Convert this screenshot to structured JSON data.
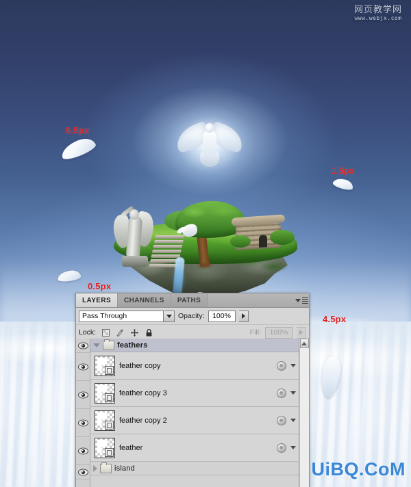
{
  "scene": {
    "title": "Floating island photo composite with doves and feathers",
    "sky_top_color": "#2c3a5e",
    "sky_bottom_color": "#f3f7fb",
    "annotation_color": "#e01f1f"
  },
  "annotations": [
    {
      "id": "feather-top-left",
      "label": "0.5px"
    },
    {
      "id": "feather-right",
      "label": "1.5px"
    },
    {
      "id": "feather-island-left",
      "label": "0.5px"
    },
    {
      "id": "feather-lower-right",
      "label": "4.5px"
    }
  ],
  "watermarks": {
    "top_right_cn": "网页教学网",
    "top_right_url": "www.webjx.com",
    "bottom_right": "UiBQ.CoM",
    "bottom_right_color": "#2b7fd4"
  },
  "panel": {
    "tabs": [
      {
        "label": "LAYERS",
        "active": true
      },
      {
        "label": "CHANNELS",
        "active": false
      },
      {
        "label": "PATHS",
        "active": false
      }
    ],
    "menu_icon": "panel-menu-icon",
    "blend": {
      "mode_value": "Pass Through",
      "opacity_label": "Opacity:",
      "opacity_value": "100%"
    },
    "lock": {
      "label": "Lock:",
      "icons": [
        "lock-transparent-pixels-icon",
        "lock-image-pixels-icon",
        "lock-position-icon",
        "lock-all-icon"
      ],
      "fill_label": "Fill:",
      "fill_value": "100%"
    },
    "layers": [
      {
        "type": "group",
        "name": "feathers",
        "visible": true,
        "expanded": true
      },
      {
        "type": "layer",
        "name": "feather copy",
        "visible": true,
        "has_fx": true
      },
      {
        "type": "layer",
        "name": "feather copy 3",
        "visible": true,
        "has_fx": true
      },
      {
        "type": "layer",
        "name": "feather copy 2",
        "visible": true,
        "has_fx": true
      },
      {
        "type": "layer",
        "name": "feather",
        "visible": true,
        "has_fx": true
      },
      {
        "type": "group",
        "name": "island",
        "visible": true,
        "expanded": false
      }
    ]
  }
}
